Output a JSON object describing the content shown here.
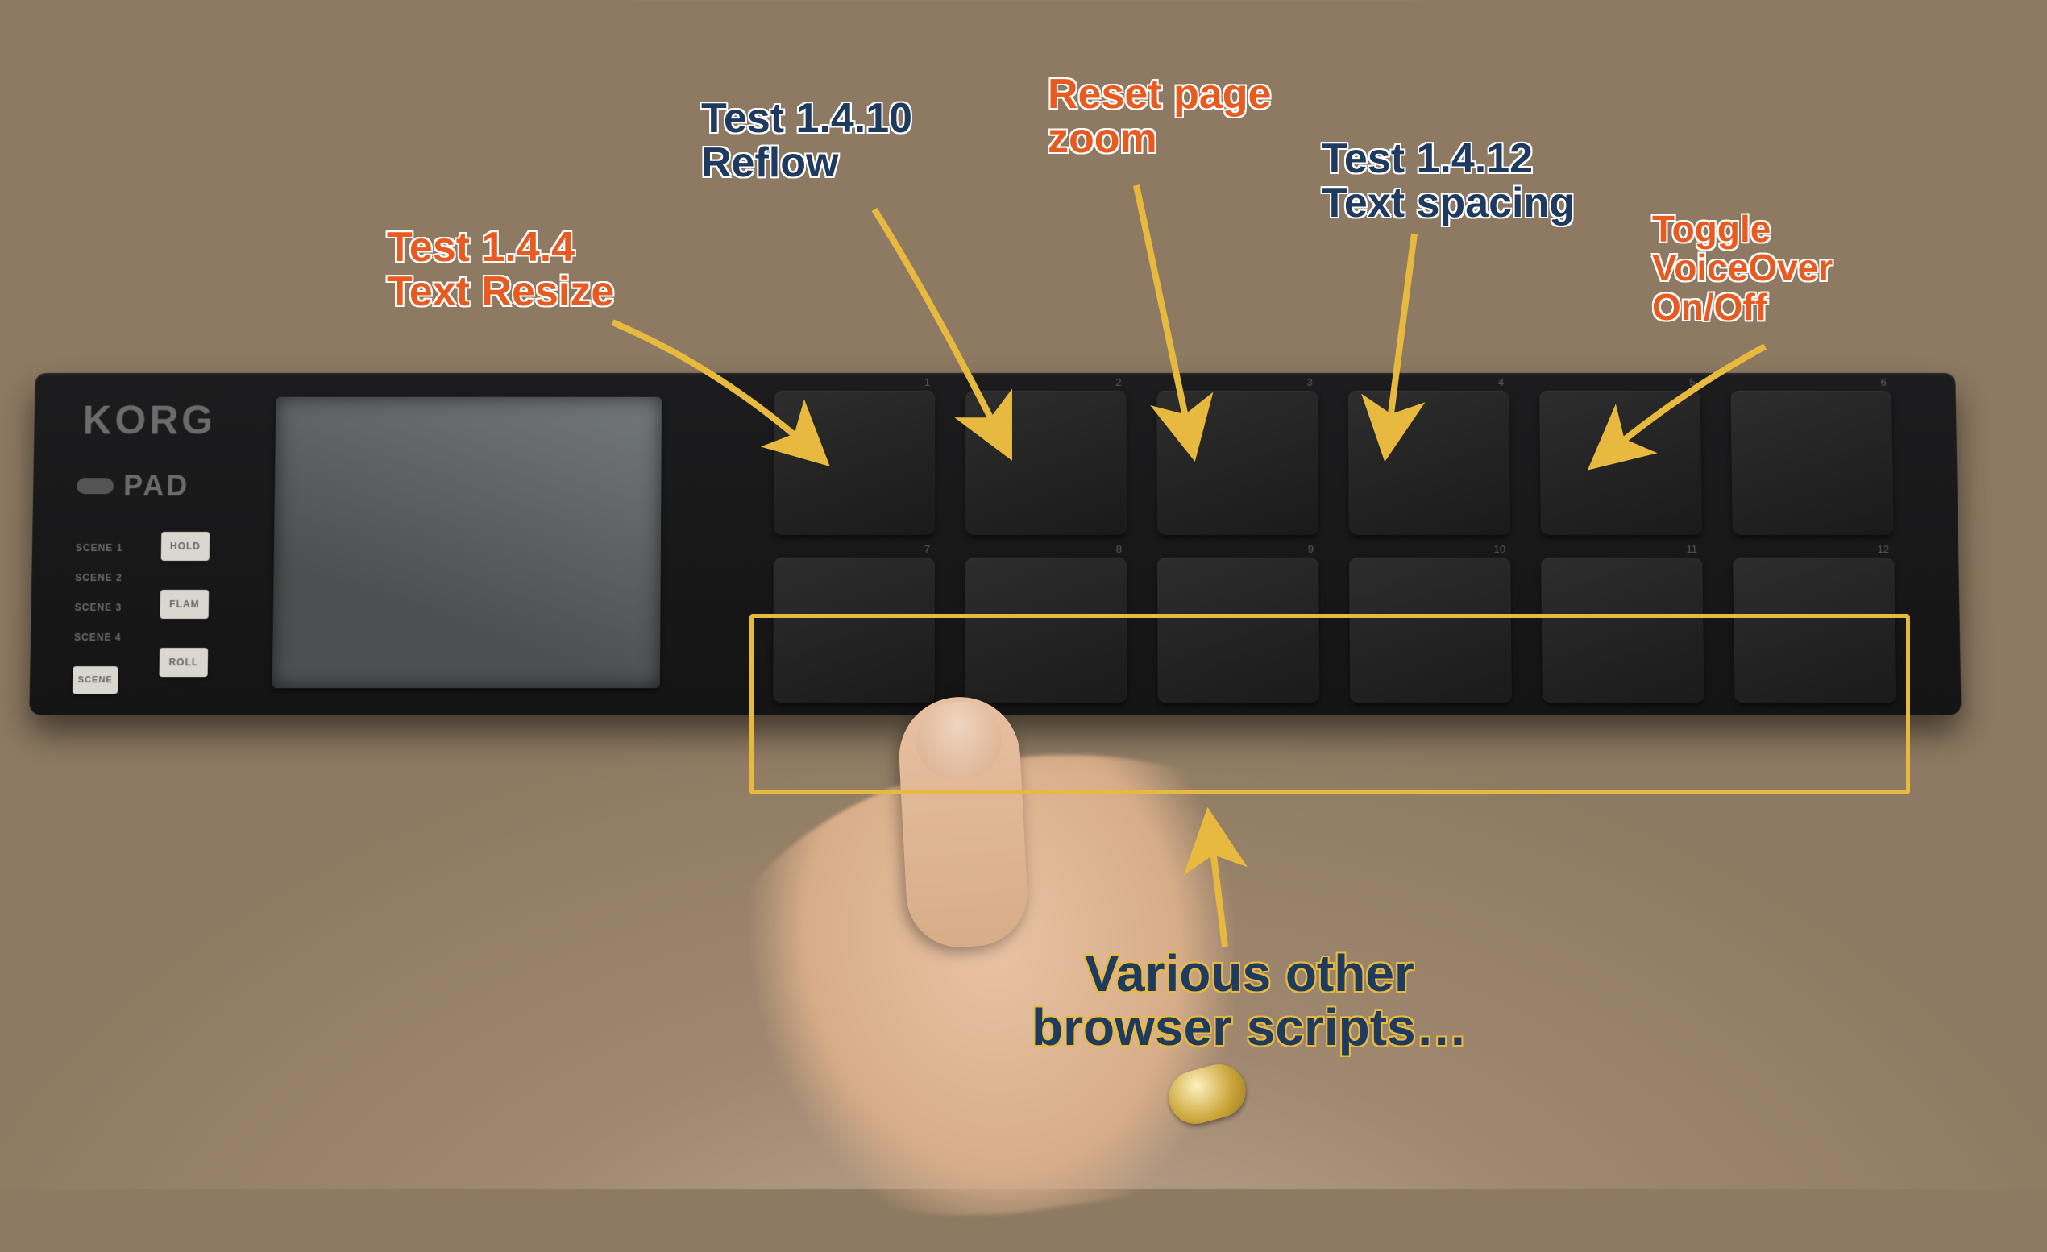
{
  "device": {
    "brand": "KORG",
    "model": "PAD",
    "scene_labels": [
      "SCENE 1",
      "SCENE 2",
      "SCENE 3",
      "SCENE 4"
    ],
    "scene_button": "SCENE",
    "mini_buttons": [
      "HOLD",
      "FLAM",
      "ROLL"
    ],
    "pad_numbers": [
      "1",
      "2",
      "3",
      "4",
      "5",
      "6",
      "7",
      "8",
      "9",
      "10",
      "11",
      "12"
    ]
  },
  "annotations": {
    "a1_line1": "Test 1.4.4",
    "a1_line2": "Text Resize",
    "a2_line1": "Test 1.4.10",
    "a2_line2": "Reflow",
    "a3_line1": "Reset page",
    "a3_line2": "zoom",
    "a4_line1": "Test 1.4.12",
    "a4_line2": "Text spacing",
    "a5_line1": "Toggle",
    "a5_line2": "VoiceOver",
    "a5_line3": "On/Off",
    "bottom_line1": "Various other",
    "bottom_line2": "browser scripts…"
  }
}
